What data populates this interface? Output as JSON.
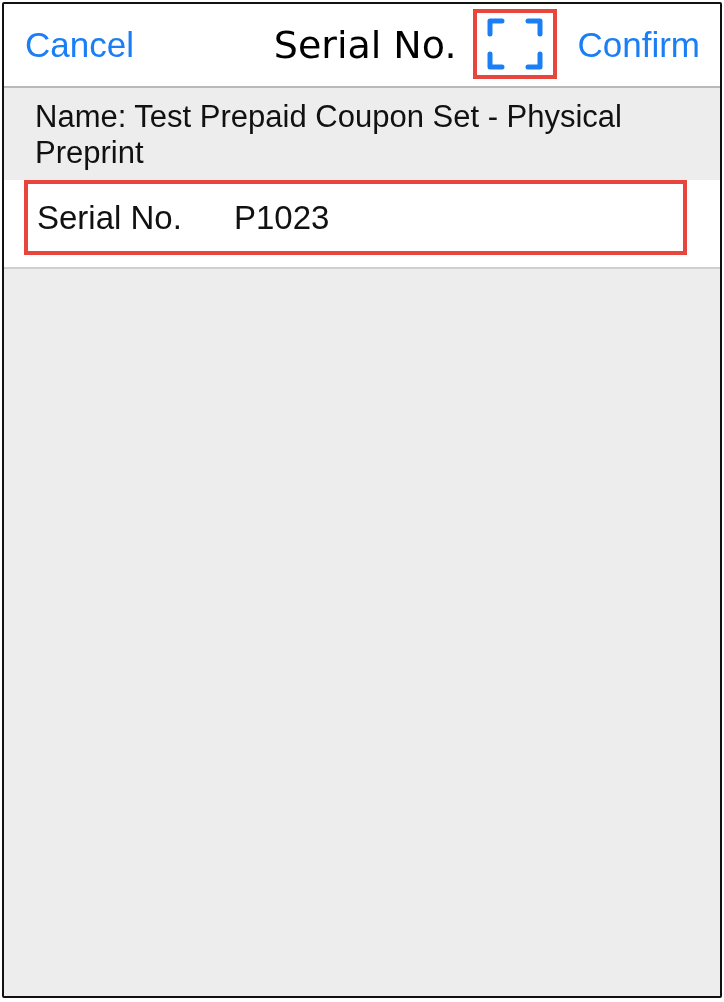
{
  "header": {
    "cancel": "Cancel",
    "title": "Serial No.",
    "scan_button": {
      "highlighted": true
    },
    "confirm": "Confirm"
  },
  "coupon": {
    "name": "Name: Test Prepaid Coupon Set - Physical Preprint"
  },
  "serial_field": {
    "label": "Serial No.",
    "value": "P1023",
    "highlighted": true
  }
}
